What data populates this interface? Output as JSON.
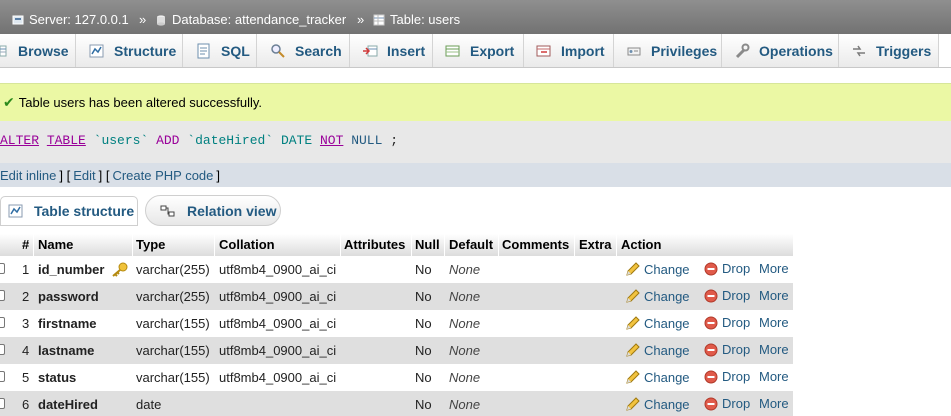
{
  "breadcrumb": {
    "server": "Server: 127.0.0.1",
    "database": "Database: attendance_tracker",
    "table": "Table: users",
    "separator": "»"
  },
  "tabs": [
    {
      "label": "Browse",
      "icon": "browse-icon"
    },
    {
      "label": "Structure",
      "icon": "structure-icon"
    },
    {
      "label": "SQL",
      "icon": "sql-icon"
    },
    {
      "label": "Search",
      "icon": "search-icon"
    },
    {
      "label": "Insert",
      "icon": "insert-icon"
    },
    {
      "label": "Export",
      "icon": "export-icon"
    },
    {
      "label": "Import",
      "icon": "import-icon"
    },
    {
      "label": "Privileges",
      "icon": "privileges-icon"
    },
    {
      "label": "Operations",
      "icon": "wrench-icon"
    },
    {
      "label": "Triggers",
      "icon": "triggers-icon"
    }
  ],
  "message": {
    "text": "Table users has been altered successfully."
  },
  "sql": {
    "alter": "ALTER",
    "table": "TABLE",
    "tname": "`users`",
    "add": "ADD",
    "col": "`dateHired`",
    "type": "DATE",
    "not": "NOT",
    "null": "NULL",
    "end": ";"
  },
  "sql_links": {
    "edit_inline": "Edit inline",
    "edit": "Edit",
    "create_php": "Create PHP code",
    "b1": "[",
    "b2": "] [",
    "b3": "] [",
    "b4": "]"
  },
  "subtabs": {
    "structure": "Table structure",
    "relation": "Relation view"
  },
  "columns": [
    "#",
    "Name",
    "Type",
    "Collation",
    "Attributes",
    "Null",
    "Default",
    "Comments",
    "Extra",
    "Action"
  ],
  "rows": [
    {
      "num": "1",
      "name": "id_number",
      "type": "varchar(255)",
      "collation": "utf8mb4_0900_ai_ci",
      "null": "No",
      "default": "None",
      "key": true
    },
    {
      "num": "2",
      "name": "password",
      "type": "varchar(255)",
      "collation": "utf8mb4_0900_ai_ci",
      "null": "No",
      "default": "None",
      "key": false
    },
    {
      "num": "3",
      "name": "firstname",
      "type": "varchar(155)",
      "collation": "utf8mb4_0900_ai_ci",
      "null": "No",
      "default": "None",
      "key": false
    },
    {
      "num": "4",
      "name": "lastname",
      "type": "varchar(155)",
      "collation": "utf8mb4_0900_ai_ci",
      "null": "No",
      "default": "None",
      "key": false
    },
    {
      "num": "5",
      "name": "status",
      "type": "varchar(155)",
      "collation": "utf8mb4_0900_ai_ci",
      "null": "No",
      "default": "None",
      "key": false
    },
    {
      "num": "6",
      "name": "dateHired",
      "type": "date",
      "collation": "",
      "null": "No",
      "default": "None",
      "key": false
    }
  ],
  "actions": {
    "change": "Change",
    "drop": "Drop",
    "more": "More"
  },
  "colors": {
    "link": "#235a81",
    "success_bg": "#ebf8a4",
    "row_even": "#dfdfdf"
  }
}
